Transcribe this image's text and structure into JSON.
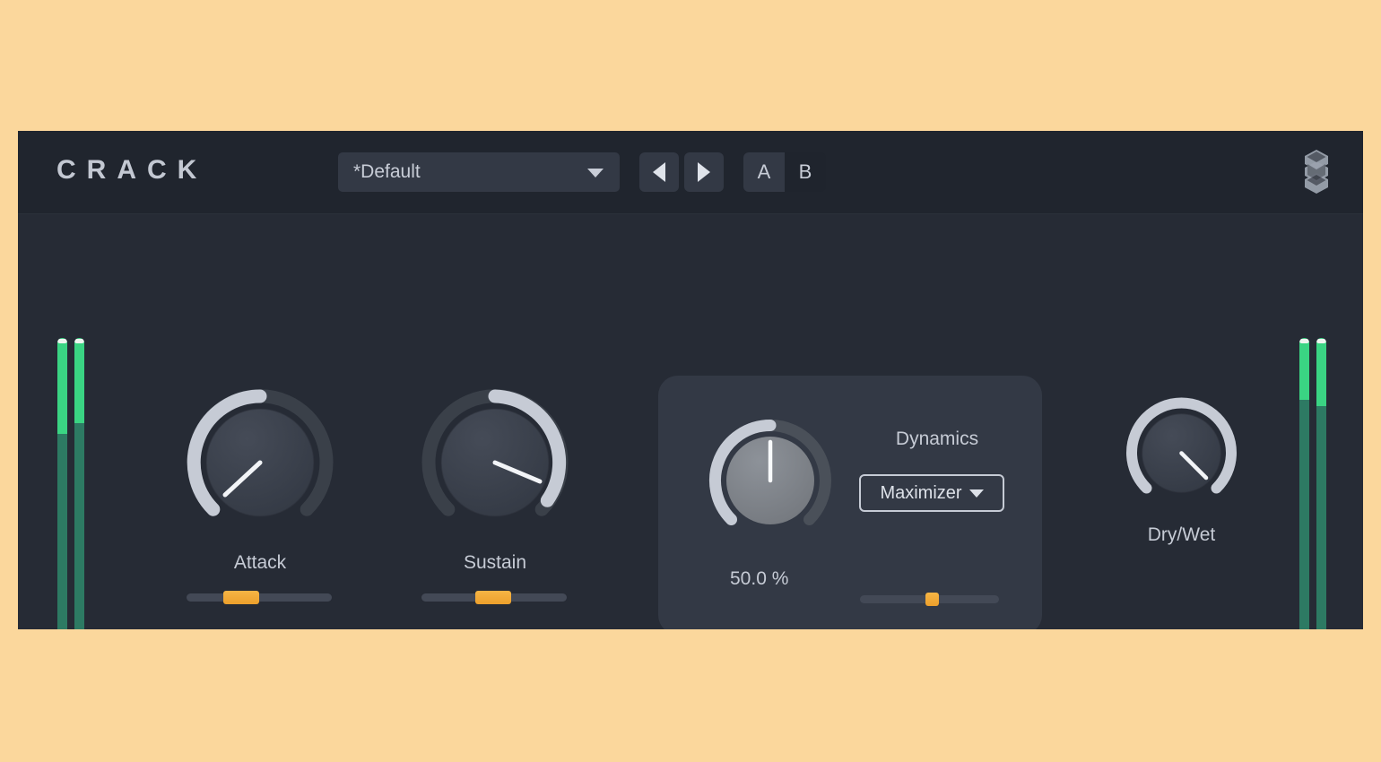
{
  "page": {
    "background_color": "#fbd79c",
    "window_bg": "#262b35",
    "header_bg": "#20252e"
  },
  "header": {
    "logo": "CRACK",
    "preset": {
      "value": "*Default",
      "chevron_icon": "chevron-down-icon"
    },
    "prev_label": "prev-preset-icon",
    "next_label": "next-preset-icon",
    "ab": {
      "a_label": "A",
      "b_label": "B",
      "selected": "B"
    },
    "brand_mark": "brand-logo-icon"
  },
  "meters": {
    "left": [
      {
        "name": "input-meter-left",
        "level_pct": 28
      },
      {
        "name": "input-meter-right",
        "level_pct": 25
      }
    ],
    "right": [
      {
        "name": "output-meter-left",
        "level_pct": 18
      },
      {
        "name": "output-meter-right",
        "level_pct": 20
      }
    ],
    "fill_color": "#3ad483",
    "track_color": "#2d7a63",
    "peak_color": "#eef4ef"
  },
  "controls": {
    "attack": {
      "label": "Attack",
      "arc_start_deg": 225,
      "arc_value_deg": 355,
      "pointer_deg": 218,
      "slider_fill_start_pct": 25,
      "slider_fill_width_pct": 25
    },
    "sustain": {
      "label": "Sustain",
      "arc_start_deg": 0,
      "arc_value_deg": 128,
      "pointer_deg": 110,
      "slider_fill_start_pct": 37,
      "slider_fill_width_pct": 25
    },
    "dynamics": {
      "title": "Dynamics",
      "value": "50.0 %",
      "mode": "Maximizer",
      "mode_chevron_icon": "chevron-down-icon",
      "arc_start_deg": 225,
      "arc_value_deg": 0,
      "pointer_deg": 0,
      "slider_marker_pct": 50
    },
    "drywet": {
      "label": "Dry/Wet",
      "arc_start_deg": 225,
      "arc_value_deg": 135,
      "pointer_deg": 135
    }
  },
  "colors": {
    "accent_orange": "#f1a733",
    "knob_arc_active": "#c6cbd5",
    "knob_arc_track": "#3a4049",
    "text": "#c6cbd5",
    "meter_green": "#3ad483"
  }
}
